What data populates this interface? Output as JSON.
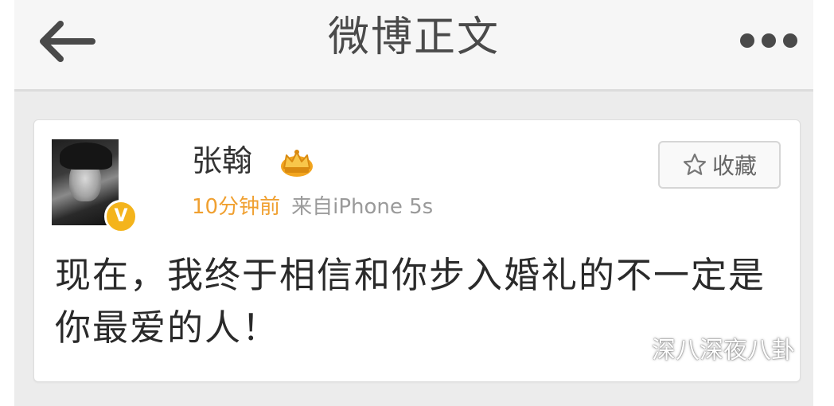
{
  "nav": {
    "back_icon": "arrow-left-icon",
    "title": "微博正文",
    "more_icon": "more-dots-icon"
  },
  "post": {
    "username": "张翰",
    "crown_icon": "crown-icon",
    "verified_badge": "V",
    "time": "10分钟前",
    "source": "来自iPhone 5s",
    "favorite_label": "收藏",
    "favorite_icon": "star-icon",
    "content": "现在，我终于相信和你步入婚礼的不一定是你最爱的人！"
  },
  "watermark": {
    "icon": "wechat-icon",
    "text": "深八深夜八卦"
  },
  "colors": {
    "badge_gold": "#f4b41c",
    "time_orange": "#f0a030",
    "meta_gray": "#9a9a9a"
  }
}
